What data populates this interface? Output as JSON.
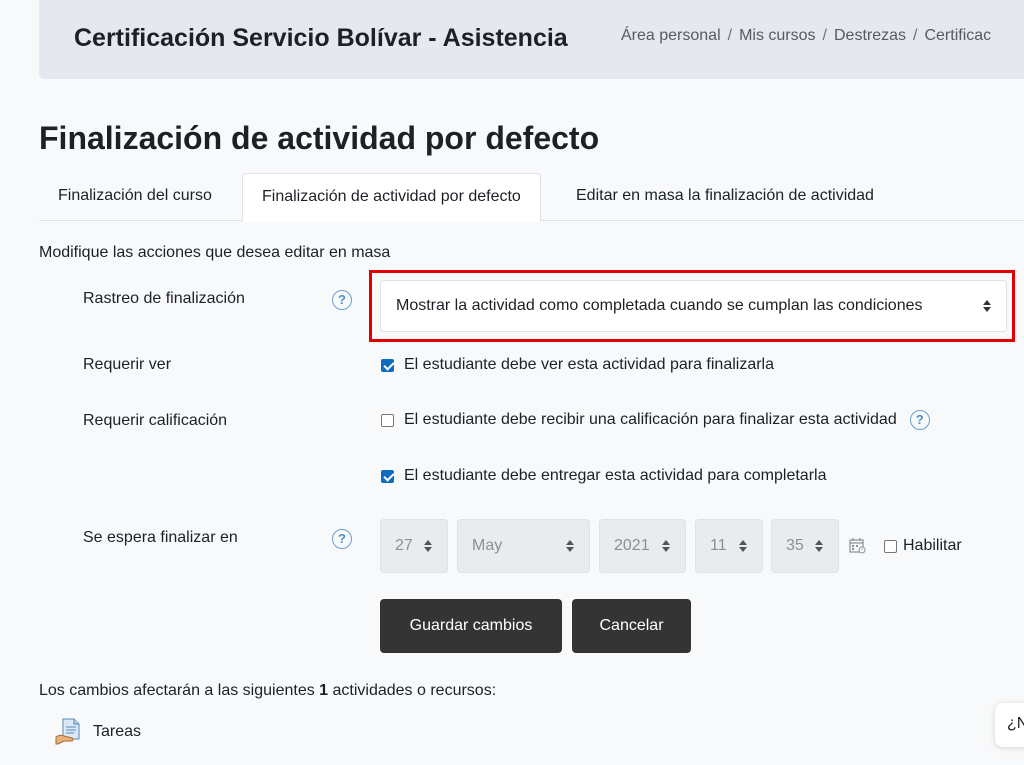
{
  "header": {
    "course_title": "Certificación Servicio Bolívar - Asistencia",
    "breadcrumb": [
      "Área personal",
      "Mis cursos",
      "Destrezas",
      "Certificac"
    ]
  },
  "page_title": "Finalización de actividad por defecto",
  "tabs": [
    {
      "label": "Finalización del curso",
      "active": false
    },
    {
      "label": "Finalización de actividad por defecto",
      "active": true
    },
    {
      "label": "Editar en masa la finalización de actividad",
      "active": false
    }
  ],
  "intro": "Modifique las acciones que desea editar en masa",
  "form": {
    "tracking": {
      "label": "Rastreo de finalización",
      "value": "Mostrar la actividad como completada cuando se cumplan las condiciones"
    },
    "require_view": {
      "label": "Requerir ver",
      "checkbox_label": "El estudiante debe ver esta actividad para finalizarla",
      "checked": true
    },
    "require_grade": {
      "label": "Requerir calificación",
      "checkbox_label": "El estudiante debe recibir una calificación para finalizar esta actividad",
      "checked": false
    },
    "require_submit": {
      "checkbox_label": "El estudiante debe entregar esta actividad para completarla",
      "checked": true
    },
    "expected": {
      "label": "Se espera finalizar en",
      "day": "27",
      "month": "May",
      "year": "2021",
      "hour": "11",
      "minute": "35",
      "enable_label": "Habilitar",
      "enabled": false
    },
    "save_label": "Guardar cambios",
    "cancel_label": "Cancelar"
  },
  "footer": {
    "text_before": "Los cambios afectarán a las siguientes ",
    "count": "1",
    "text_after": " actividades o recursos:",
    "item_label": "Tareas"
  },
  "help_bubble": "¿N",
  "colors": {
    "highlight_border": "#e30000",
    "button_bg": "#343434",
    "checkbox_checked": "#0f6cbf",
    "help_icon": "#4f8fca"
  },
  "icons": {
    "help": "question-circle-icon",
    "calendar": "calendar-icon",
    "assignment": "assignment-icon"
  }
}
